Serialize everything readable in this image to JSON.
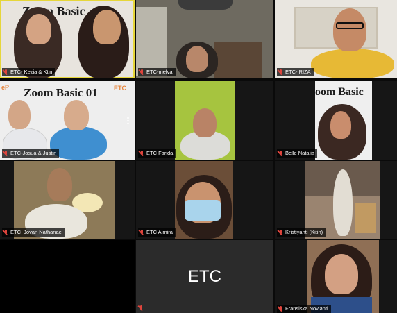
{
  "meeting": {
    "participants": [
      {
        "id": "t1",
        "name": "ETC- Kezia & Ktin",
        "banner": "Zoom Basic"
      },
      {
        "id": "t2",
        "name": "ETC-melva"
      },
      {
        "id": "t3",
        "name": "ETC- RIZA"
      },
      {
        "id": "t4",
        "name": "ETC-Josua & Justin",
        "banner": "Zoom Basic 01",
        "logo": "ETC",
        "logo_left": "eP"
      },
      {
        "id": "t5",
        "name": "ETC Farida"
      },
      {
        "id": "t6",
        "name": "Belle Natalia",
        "banner": "oom Basic"
      },
      {
        "id": "t7",
        "name": "ETC_Jovan Nathanael"
      },
      {
        "id": "t8",
        "name": "ETC Almira"
      },
      {
        "id": "t9",
        "name": "Kristiyanti (Kitin)"
      },
      {
        "id": "t10",
        "name": ""
      },
      {
        "id": "t11",
        "name": "",
        "placeholder": "ETC"
      },
      {
        "id": "t12",
        "name": "Fransiska Novianti"
      }
    ]
  },
  "colors": {
    "active_speaker_border": "#e6d63a",
    "muted_icon": "#e0453d",
    "etc_logo": "#e7843a"
  },
  "icons": {
    "muted": "mic-muted-icon",
    "more": "more-options-icon"
  }
}
